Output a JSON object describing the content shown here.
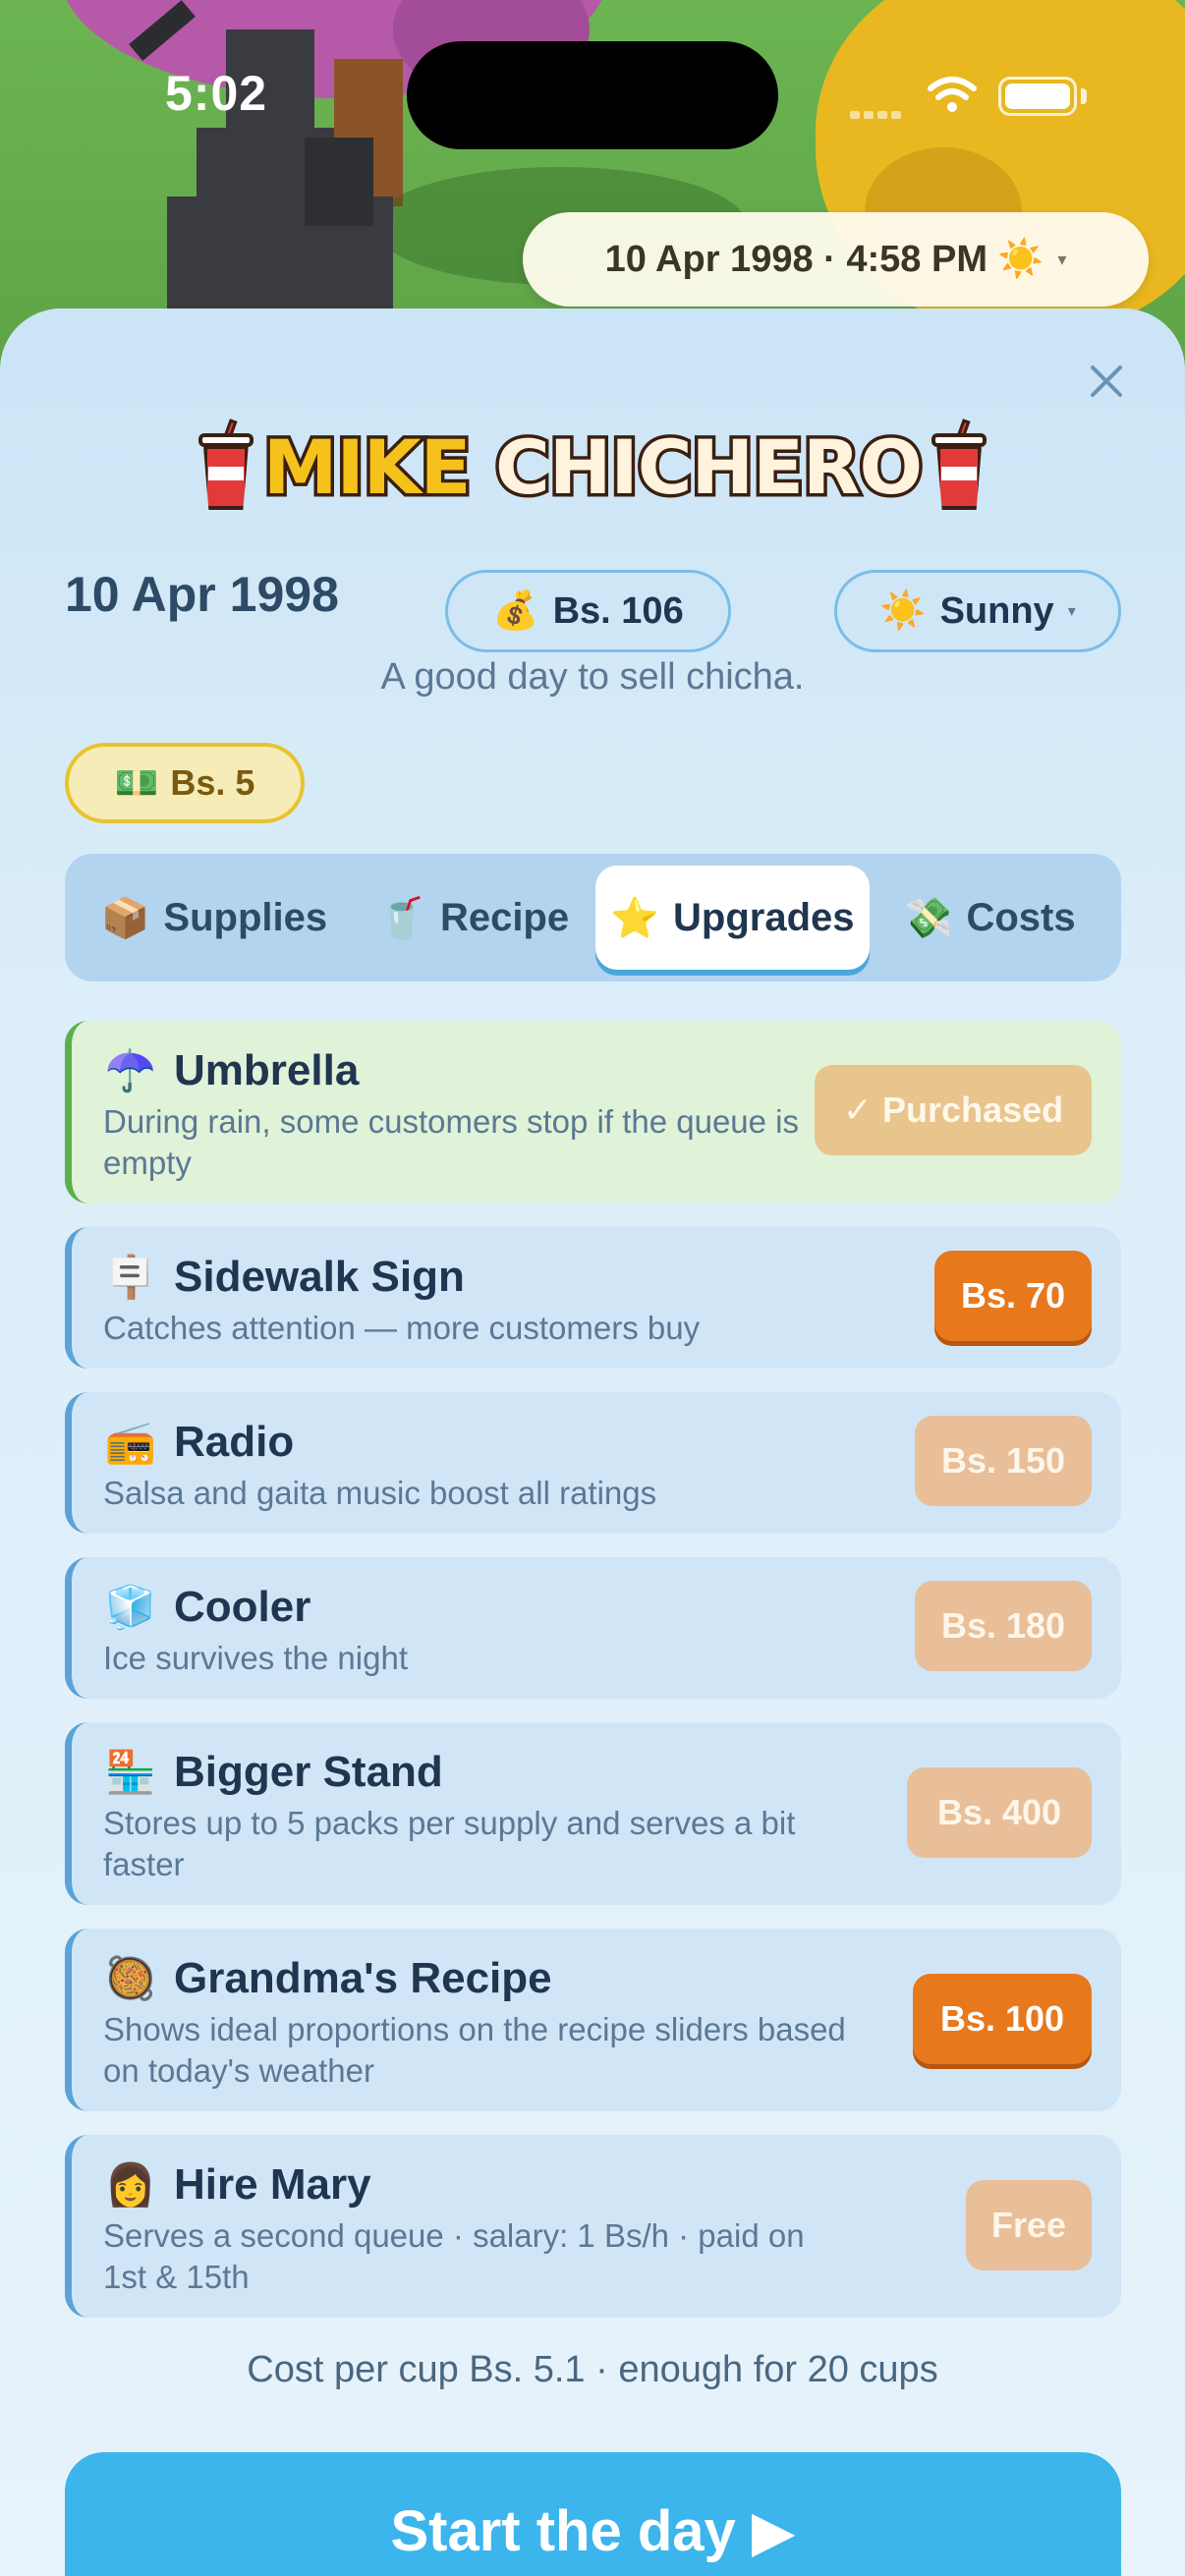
{
  "status_bar": {
    "time": "5:02"
  },
  "datetime_pill": {
    "text": "10 Apr 1998 · 4:58 PM",
    "icon": "☀️",
    "caret": "▾"
  },
  "logo": {
    "word1": "MIKE",
    "word2": "CHICHERO"
  },
  "header": {
    "date": "10 Apr 1998",
    "money": {
      "icon": "💰",
      "label": "Bs. 106"
    },
    "weather": {
      "icon": "☀️",
      "label": "Sunny",
      "caret": "▾"
    },
    "tagline": "A good day to sell chicha."
  },
  "cash_chip": {
    "icon": "💵",
    "label": "Bs. 5"
  },
  "tabs": [
    {
      "icon": "📦",
      "label": "Supplies"
    },
    {
      "icon": "🥤",
      "label": "Recipe"
    },
    {
      "icon": "⭐",
      "label": "Upgrades",
      "active": true
    },
    {
      "icon": "💸",
      "label": "Costs"
    }
  ],
  "upgrades": [
    {
      "icon": "☂️",
      "name": "Umbrella",
      "desc": "During rain, some customers stop if the queue is empty",
      "button": "✓ Purchased",
      "state": "purchased"
    },
    {
      "icon": "🪧",
      "name": "Sidewalk Sign",
      "desc": "Catches attention — more customers buy",
      "button": "Bs. 70",
      "state": "buy"
    },
    {
      "icon": "📻",
      "name": "Radio",
      "desc": "Salsa and gaita music boost all ratings",
      "button": "Bs. 150",
      "state": "locked"
    },
    {
      "icon": "🧊",
      "name": "Cooler",
      "desc": "Ice survives the night",
      "button": "Bs. 180",
      "state": "locked"
    },
    {
      "icon": "🏪",
      "name": "Bigger Stand",
      "desc": "Stores up to 5 packs per supply and serves a bit faster",
      "button": "Bs. 400",
      "state": "locked"
    },
    {
      "icon": "🥘",
      "name": "Grandma's Recipe",
      "desc": "Shows ideal proportions on the recipe sliders based on today's weather",
      "button": "Bs. 100",
      "state": "buy"
    },
    {
      "icon": "👩",
      "name": "Hire Mary",
      "desc": "Serves a second queue · salary: 1 Bs/h · paid on 1st & 15th",
      "button": "Free",
      "state": "locked"
    }
  ],
  "footer": {
    "cost_note": "Cost per cup Bs. 5.1 · enough for 20 cups",
    "start_button": "Start the day ▶"
  },
  "colors": {
    "accent_orange": "#e8781c",
    "accent_blue": "#3bb5ec",
    "purchased_green": "#5bb04c"
  }
}
